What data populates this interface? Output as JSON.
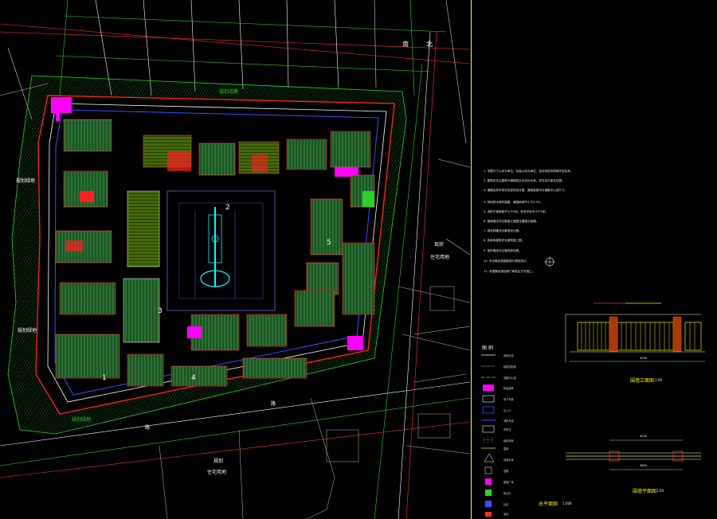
{
  "drawing": {
    "block_numbers": [
      "1",
      "2",
      "3",
      "4",
      "5"
    ],
    "road_label_top": "路",
    "road_label_bottom": "路",
    "street_label_top": "南",
    "street_label_top2": "北",
    "land_label_top": "规划道路",
    "land_label_left": "规划绿地",
    "land_label_left2": "规划绿地",
    "land_label_right": "住宅用地",
    "land_label_right2": "现状",
    "land_label_bottom": "规划绿地",
    "land_label_bottom_right": "住宅用地",
    "land_label_bottom_right2": "规划"
  },
  "notes": {
    "lines": [
      "1. 本图尺寸以米为单位，标高以米为单位，坐标系统采用城市坐标系。",
      "2. 建筑定位以建筑外墙轴线交点坐标为准，详见总平面定位图。",
      "3. 道路及停车场详见竖向设计图，道路宽度均为道路中心线尺寸。",
      "4. 场地排水坡向道路，道路纵坡不小于0.3%。",
      "5. 消防车道宽度不小于4米，转弯半径不小于9米。",
      "6. 围墙做法详见围墙立面图及围墙平面图。",
      "7. 绿化种植详见景观设计图。",
      "8. 各单体建筑详见建筑施工图。",
      "9. 室外管线详见管线综合图。",
      "10. 未尽事宜按国家现行规范执行。",
      "11. 本图需经规划部门审批后方可施工。"
    ]
  },
  "wall": {
    "elevation_title": "围墙立面图",
    "elevation_scale": "1:50",
    "plan_title": "围墙平面图",
    "plan_scale": "1:50",
    "dims": [
      "4200",
      "3600",
      "4200"
    ]
  },
  "legend": {
    "title": "图 例",
    "footer_title": "总平面图",
    "footer_scale": "1:500",
    "items": [
      "用地红线",
      "建筑控制线",
      "道路中心线",
      "新建建筑",
      "地下车库",
      "出入口",
      "消防车道",
      "停车位",
      "绿化用地",
      "围墙",
      "景观水体",
      "道路",
      "铺装广场",
      "指北针",
      "标高",
      "坐标"
    ]
  },
  "colors": {
    "background": "#000000",
    "greenery_hatch": "#2fbf2f",
    "buildings": "#f2f200",
    "magenta": "#ff00ff",
    "red": "#ff2020",
    "cyan": "#00ffff",
    "blue": "#3a4dff",
    "white": "#ffffff",
    "frame": "#ffff00"
  }
}
